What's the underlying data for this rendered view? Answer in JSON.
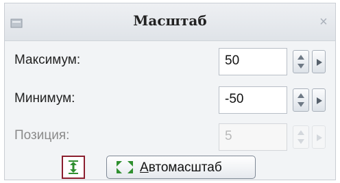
{
  "dialog": {
    "title": "Масштаб"
  },
  "rows": [
    {
      "label": "Максимум:",
      "value": "50",
      "enabled": true
    },
    {
      "label": "Минимум:",
      "value": "-50",
      "enabled": true
    },
    {
      "label": "Позиция:",
      "value": "5",
      "enabled": false
    }
  ],
  "bottom": {
    "auto_button_label": "Автомасштаб"
  },
  "colors": {
    "accent_red": "#8b1e2e",
    "accent_green": "#2f8f2f"
  }
}
